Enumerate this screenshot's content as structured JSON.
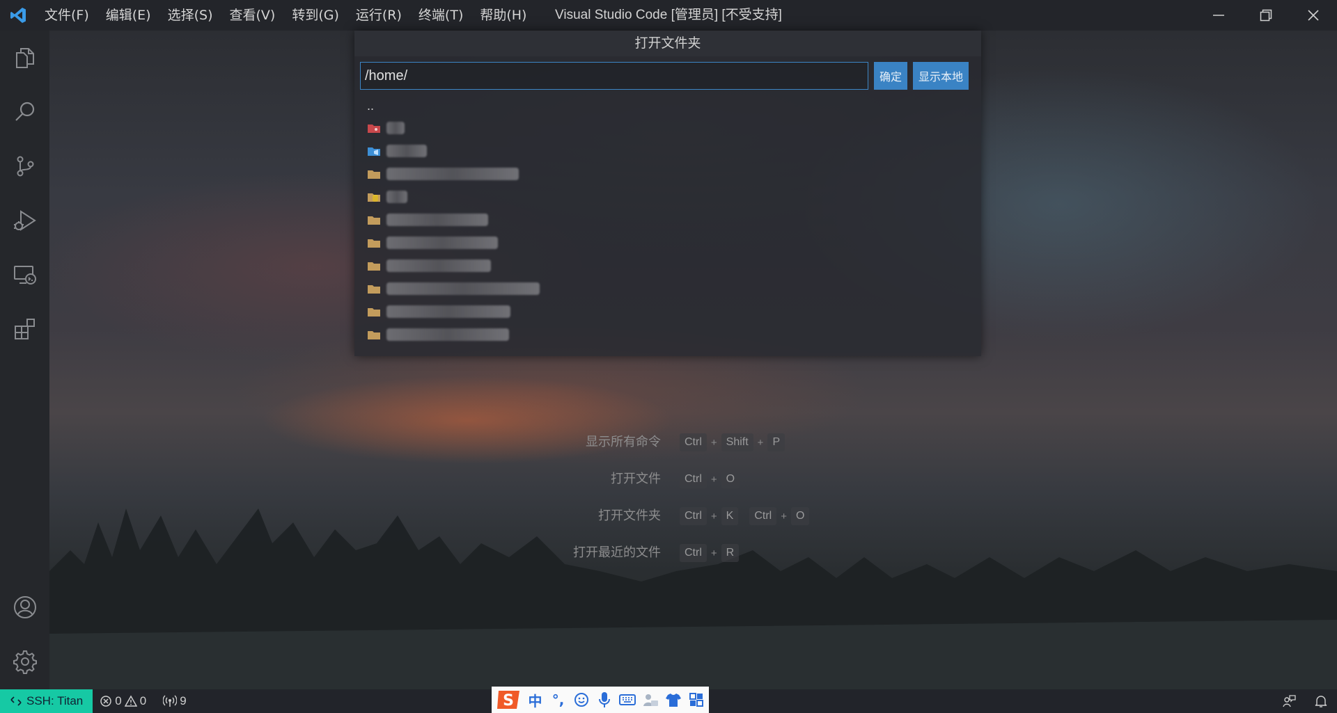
{
  "titlebar": {
    "app_icon": "vscode-logo-icon",
    "menu": [
      "文件(F)",
      "编辑(E)",
      "选择(S)",
      "查看(V)",
      "转到(G)",
      "运行(R)",
      "终端(T)",
      "帮助(H)"
    ],
    "title": "Visual Studio Code [管理员] [不受支持]",
    "controls": [
      "minimize-icon",
      "restore-icon",
      "close-icon"
    ]
  },
  "activitybar": {
    "items": [
      "explorer-icon",
      "search-icon",
      "source-control-icon",
      "run-debug-icon",
      "remote-explorer-icon",
      "extensions-icon"
    ],
    "bottom": [
      "account-icon",
      "settings-gear-icon"
    ]
  },
  "quick_open": {
    "title": "打开文件夹",
    "path_value": "/home/",
    "ok_label": "确定",
    "show_local_label": "显示本地",
    "parent_label": "..",
    "entries": [
      {
        "icon": "git-folder-icon",
        "color": "#c8484c"
      },
      {
        "icon": "vscode-folder-icon",
        "color": "#3d8fd6"
      },
      {
        "icon": "folder-icon",
        "color": "#c39c5c"
      },
      {
        "icon": "database-folder-icon",
        "color": "#d9b42c"
      },
      {
        "icon": "folder-icon",
        "color": "#c39c5c"
      },
      {
        "icon": "folder-icon",
        "color": "#c39c5c"
      },
      {
        "icon": "folder-icon",
        "color": "#c39c5c"
      },
      {
        "icon": "folder-icon",
        "color": "#c39c5c"
      },
      {
        "icon": "folder-icon",
        "color": "#c39c5c"
      },
      {
        "icon": "folder-icon",
        "color": "#c39c5c"
      }
    ]
  },
  "shortcuts": [
    {
      "label": "显示所有命令",
      "keys": [
        [
          "Ctrl",
          "Shift",
          "P"
        ]
      ]
    },
    {
      "label": "打开文件",
      "keys": [
        [
          "Ctrl",
          "O"
        ]
      ]
    },
    {
      "label": "打开文件夹",
      "keys": [
        [
          "Ctrl",
          "K"
        ],
        [
          "Ctrl",
          "O"
        ]
      ]
    },
    {
      "label": "打开最近的文件",
      "keys": [
        [
          "Ctrl",
          "R"
        ]
      ]
    }
  ],
  "statusbar": {
    "remote": "SSH: Titan",
    "errors": "0",
    "warnings": "0",
    "ports": "9",
    "accent": "#16c9a4"
  },
  "ime": {
    "items": [
      "中",
      "°,",
      "emoji-icon",
      "microphone-icon",
      "keyboard-icon",
      "user-icon",
      "shirt-icon",
      "grid-icon"
    ]
  }
}
